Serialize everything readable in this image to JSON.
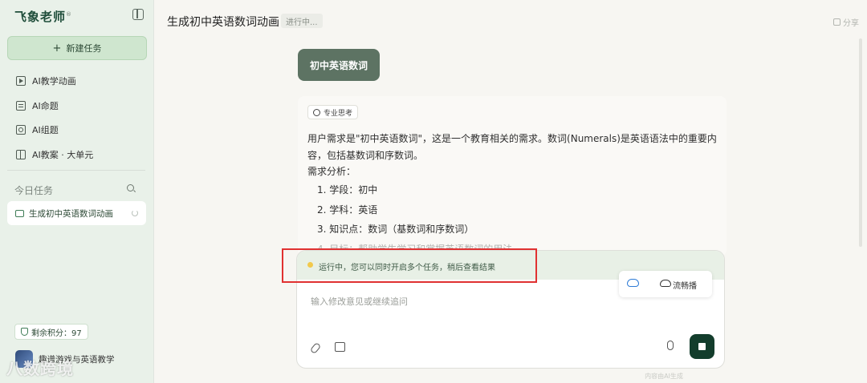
{
  "sidebar": {
    "logo": "飞象老师",
    "logo_mark": "®",
    "new_task_label": "新建任务",
    "items": [
      {
        "label": "AI教学动画",
        "icon": "play-icon"
      },
      {
        "label": "AI命题",
        "icon": "doc-icon"
      },
      {
        "label": "AI组题",
        "icon": "image-icon"
      },
      {
        "label": "AI教案 · 大单元",
        "icon": "book-icon"
      }
    ],
    "today_label": "今日任务",
    "tasks": [
      {
        "label": "生成初中英语数词动画",
        "status": "running"
      }
    ],
    "points_label": "剩余积分：97",
    "user_name": "趣谱游戏与英语教学"
  },
  "watermark": "八数跨境",
  "header": {
    "title": "生成初中英语数词动画",
    "status": "进行中...",
    "share_label": "分享"
  },
  "conversation": {
    "user_message": "初中英语数词",
    "think_tag": "专业思考",
    "paragraph": "用户需求是\"初中英语数词\"，这是一个教育相关的需求。数词(Numerals)是英语语法中的重要内容，包括基数词和序数词。",
    "analysis_title": "需求分析：",
    "analysis_items": [
      "1. 学段：初中",
      "2. 学科：英语",
      "3. 知识点：数词（基数词和序数词）",
      "4. 目标：帮助学生学习和掌握英语数词的用法"
    ]
  },
  "composer": {
    "running_notice": "运行中，您可以同时开启多个任务，稍后查看结果",
    "stream_label": "流畅播",
    "placeholder": "输入修改意见或继续追问"
  },
  "footer_note": "内容由AI生成",
  "colors": {
    "accent": "#133d2c",
    "sidebar_bg": "#e9f1e9",
    "bubble": "#5d7363",
    "highlight": "#e03131"
  }
}
